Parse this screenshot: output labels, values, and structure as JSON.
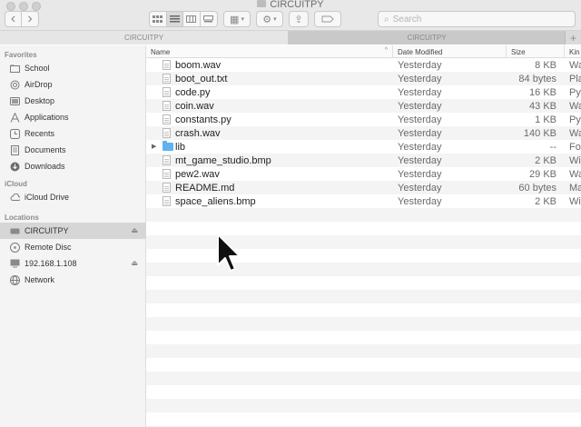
{
  "window": {
    "title": "CIRCUITPY"
  },
  "toolbar": {
    "back_icon": "chevron-left-icon",
    "forward_icon": "chevron-right-icon",
    "view_modes": [
      "icon-view",
      "list-view",
      "column-view",
      "gallery-view"
    ],
    "active_view": "list-view",
    "search_placeholder": "Search"
  },
  "tabs": [
    {
      "label": "CIRCUITPY",
      "active": true
    },
    {
      "label": "CIRCUITPY",
      "active": false
    }
  ],
  "sidebar": {
    "sections": [
      {
        "heading": "Favorites",
        "items": [
          {
            "label": "School",
            "icon": "folder-icon"
          },
          {
            "label": "AirDrop",
            "icon": "airdrop-icon"
          },
          {
            "label": "Desktop",
            "icon": "desktop-icon"
          },
          {
            "label": "Applications",
            "icon": "applications-icon"
          },
          {
            "label": "Recents",
            "icon": "recents-icon"
          },
          {
            "label": "Documents",
            "icon": "documents-icon"
          },
          {
            "label": "Downloads",
            "icon": "downloads-icon"
          }
        ]
      },
      {
        "heading": "iCloud",
        "items": [
          {
            "label": "iCloud Drive",
            "icon": "cloud-icon"
          }
        ]
      },
      {
        "heading": "Locations",
        "items": [
          {
            "label": "CIRCUITPY",
            "icon": "drive-icon",
            "selected": true,
            "eject": true
          },
          {
            "label": "Remote Disc",
            "icon": "disc-icon"
          },
          {
            "label": "192.168.1.108",
            "icon": "display-icon",
            "eject": true
          },
          {
            "label": "Network",
            "icon": "network-icon"
          }
        ]
      }
    ]
  },
  "columns": {
    "name": "Name",
    "date": "Date Modified",
    "size": "Size",
    "kind": "Kin"
  },
  "files": [
    {
      "name": "boom.wav",
      "date": "Yesterday",
      "size": "8 KB",
      "kind": "Wa"
    },
    {
      "name": "boot_out.txt",
      "date": "Yesterday",
      "size": "84 bytes",
      "kind": "Pla"
    },
    {
      "name": "code.py",
      "date": "Yesterday",
      "size": "16 KB",
      "kind": "Py"
    },
    {
      "name": "coin.wav",
      "date": "Yesterday",
      "size": "43 KB",
      "kind": "Wa"
    },
    {
      "name": "constants.py",
      "date": "Yesterday",
      "size": "1 KB",
      "kind": "Py"
    },
    {
      "name": "crash.wav",
      "date": "Yesterday",
      "size": "140 KB",
      "kind": "Wa"
    },
    {
      "name": "lib",
      "date": "Yesterday",
      "size": "--",
      "kind": "Fo",
      "folder": true
    },
    {
      "name": "mt_game_studio.bmp",
      "date": "Yesterday",
      "size": "2 KB",
      "kind": "Wi"
    },
    {
      "name": "pew2.wav",
      "date": "Yesterday",
      "size": "29 KB",
      "kind": "Wa"
    },
    {
      "name": "README.md",
      "date": "Yesterday",
      "size": "60 bytes",
      "kind": "Ma"
    },
    {
      "name": "space_aliens.bmp",
      "date": "Yesterday",
      "size": "2 KB",
      "kind": "Wi"
    }
  ],
  "colors": {
    "folder": "#5fb3ee",
    "selection": "#d6d6d6",
    "stripe": "#f4f4f4"
  }
}
